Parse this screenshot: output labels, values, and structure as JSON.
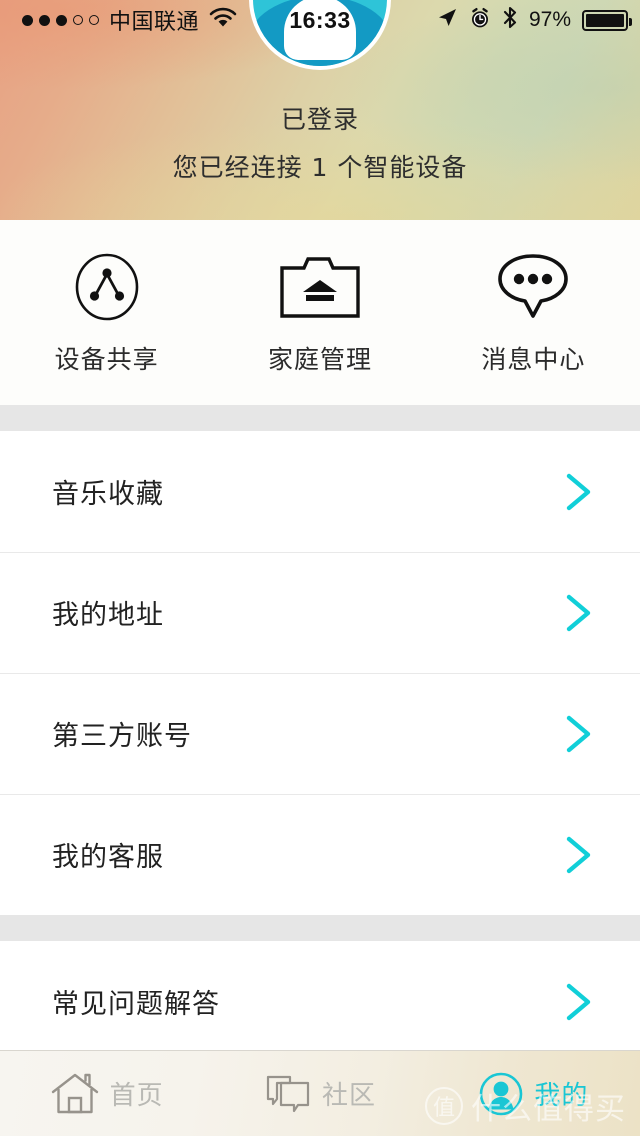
{
  "status_bar": {
    "signal_dots_filled": 3,
    "signal_dots_total": 5,
    "carrier": "中国联通",
    "wifi_icon": "wifi-icon",
    "time": "16:33",
    "location_icon": "location-arrow-icon",
    "alarm_icon": "alarm-clock-icon",
    "bluetooth_icon": "bluetooth-icon",
    "battery_percent": "97%",
    "battery_level": 97
  },
  "header": {
    "avatar_icon": "user-avatar",
    "login_status": "已登录",
    "device_summary": "您已经连接 1 个智能设备"
  },
  "quick_actions": [
    {
      "label": "设备共享",
      "icon": "device-share-icon"
    },
    {
      "label": "家庭管理",
      "icon": "family-home-icon"
    },
    {
      "label": "消息中心",
      "icon": "message-bubble-icon"
    }
  ],
  "list_groups": [
    {
      "items": [
        {
          "label": "音乐收藏",
          "chevron": "chevron-right-icon"
        },
        {
          "label": "我的地址",
          "chevron": "chevron-right-icon"
        },
        {
          "label": "第三方账号",
          "chevron": "chevron-right-icon"
        },
        {
          "label": "我的客服",
          "chevron": "chevron-right-icon"
        }
      ]
    },
    {
      "items": [
        {
          "label": "常见问题解答",
          "chevron": "chevron-right-icon"
        }
      ]
    }
  ],
  "tabbar": {
    "items": [
      {
        "label": "首页",
        "icon": "home-icon",
        "active": false
      },
      {
        "label": "社区",
        "icon": "community-chat-icon",
        "active": false
      },
      {
        "label": "我的",
        "icon": "profile-person-icon",
        "active": true
      }
    ]
  },
  "watermark": {
    "badge": "值",
    "text": "什么值得买"
  },
  "colors": {
    "accent_cyan": "#19c6d4",
    "chevron_cyan": "#11cfd8",
    "avatar_light": "#2ec4d8",
    "avatar_dark": "#139ac4",
    "section_gap": "#e6e6e6",
    "text_primary": "#222222",
    "tab_inactive": "#b9b9b4"
  }
}
